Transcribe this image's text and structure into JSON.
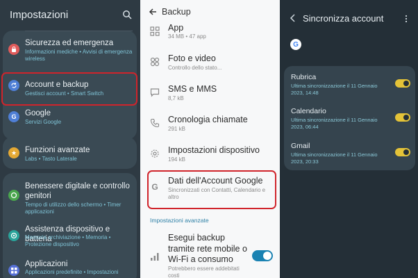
{
  "colors": {
    "accent_red": "#d0242b",
    "toggle_blue": "#1a82b2",
    "toggle_yellow": "#e4c338",
    "link_cyan": "#7fc3d6"
  },
  "settings": {
    "title": "Impostazioni",
    "items": [
      {
        "icon": "shield-alert-icon",
        "title": "Sicurezza ed emergenza",
        "subtitle": "Informazioni mediche • Avvisi di emergenza wireless"
      },
      {
        "icon": "sync-icon",
        "title": "Account e backup",
        "subtitle": "Gestisci account • Smart Switch"
      },
      {
        "icon": "google-icon",
        "title": "Google",
        "subtitle": "Servizi Google"
      },
      {
        "icon": "star-icon",
        "title": "Funzioni avanzate",
        "subtitle": "Labs • Tasto Laterale"
      },
      {
        "icon": "wellbeing-icon",
        "title": "Benessere digitale e controllo genitori",
        "subtitle": "Tempo di utilizzo dello schermo • Timer applicazioni"
      },
      {
        "icon": "device-care-icon",
        "title": "Assistenza dispositivo e batteria",
        "subtitle": "Memoria archiviazione • Memoria • Protezione dispositivo"
      },
      {
        "icon": "apps-icon",
        "title": "Applicazioni",
        "subtitle": "Applicazioni predefinite • Impostazioni"
      }
    ]
  },
  "backup": {
    "title": "Backup",
    "items": [
      {
        "icon": "apps-grid-icon",
        "title": "App",
        "subtitle": "34 MB • 47 app"
      },
      {
        "icon": "photo-icon",
        "title": "Foto e video",
        "subtitle": "Controllo dello stato..."
      },
      {
        "icon": "message-icon",
        "title": "SMS e MMS",
        "subtitle": "8,7 kB"
      },
      {
        "icon": "call-log-icon",
        "title": "Cronologia chiamate",
        "subtitle": "291 kB"
      },
      {
        "icon": "gear-icon",
        "title": "Impostazioni dispositivo",
        "subtitle": "194 kB"
      },
      {
        "icon": "google-g-icon",
        "title": "Dati dell'Account Google",
        "subtitle": "Sincronizzati con Contatti, Calendario e altro"
      }
    ],
    "advanced_header": "Impostazioni avanzate",
    "mobile_backup": {
      "title": "Esegui backup tramite rete mobile o Wi-Fi a consumo",
      "subtitle": "Potrebbero essere addebitati costi",
      "enabled": true
    }
  },
  "sync": {
    "title": "Sincronizza account",
    "items": [
      {
        "title": "Rubrica",
        "subtitle": "Ultima sincronizzazione il 11 Gennaio 2023, 14:48",
        "enabled": true
      },
      {
        "title": "Calendario",
        "subtitle": "Ultima sincronizzazione il 11 Gennaio 2023, 06:44",
        "enabled": true
      },
      {
        "title": "Gmail",
        "subtitle": "Ultima sincronizzazione il 11 Gennaio 2023, 20:33",
        "enabled": true
      }
    ]
  }
}
